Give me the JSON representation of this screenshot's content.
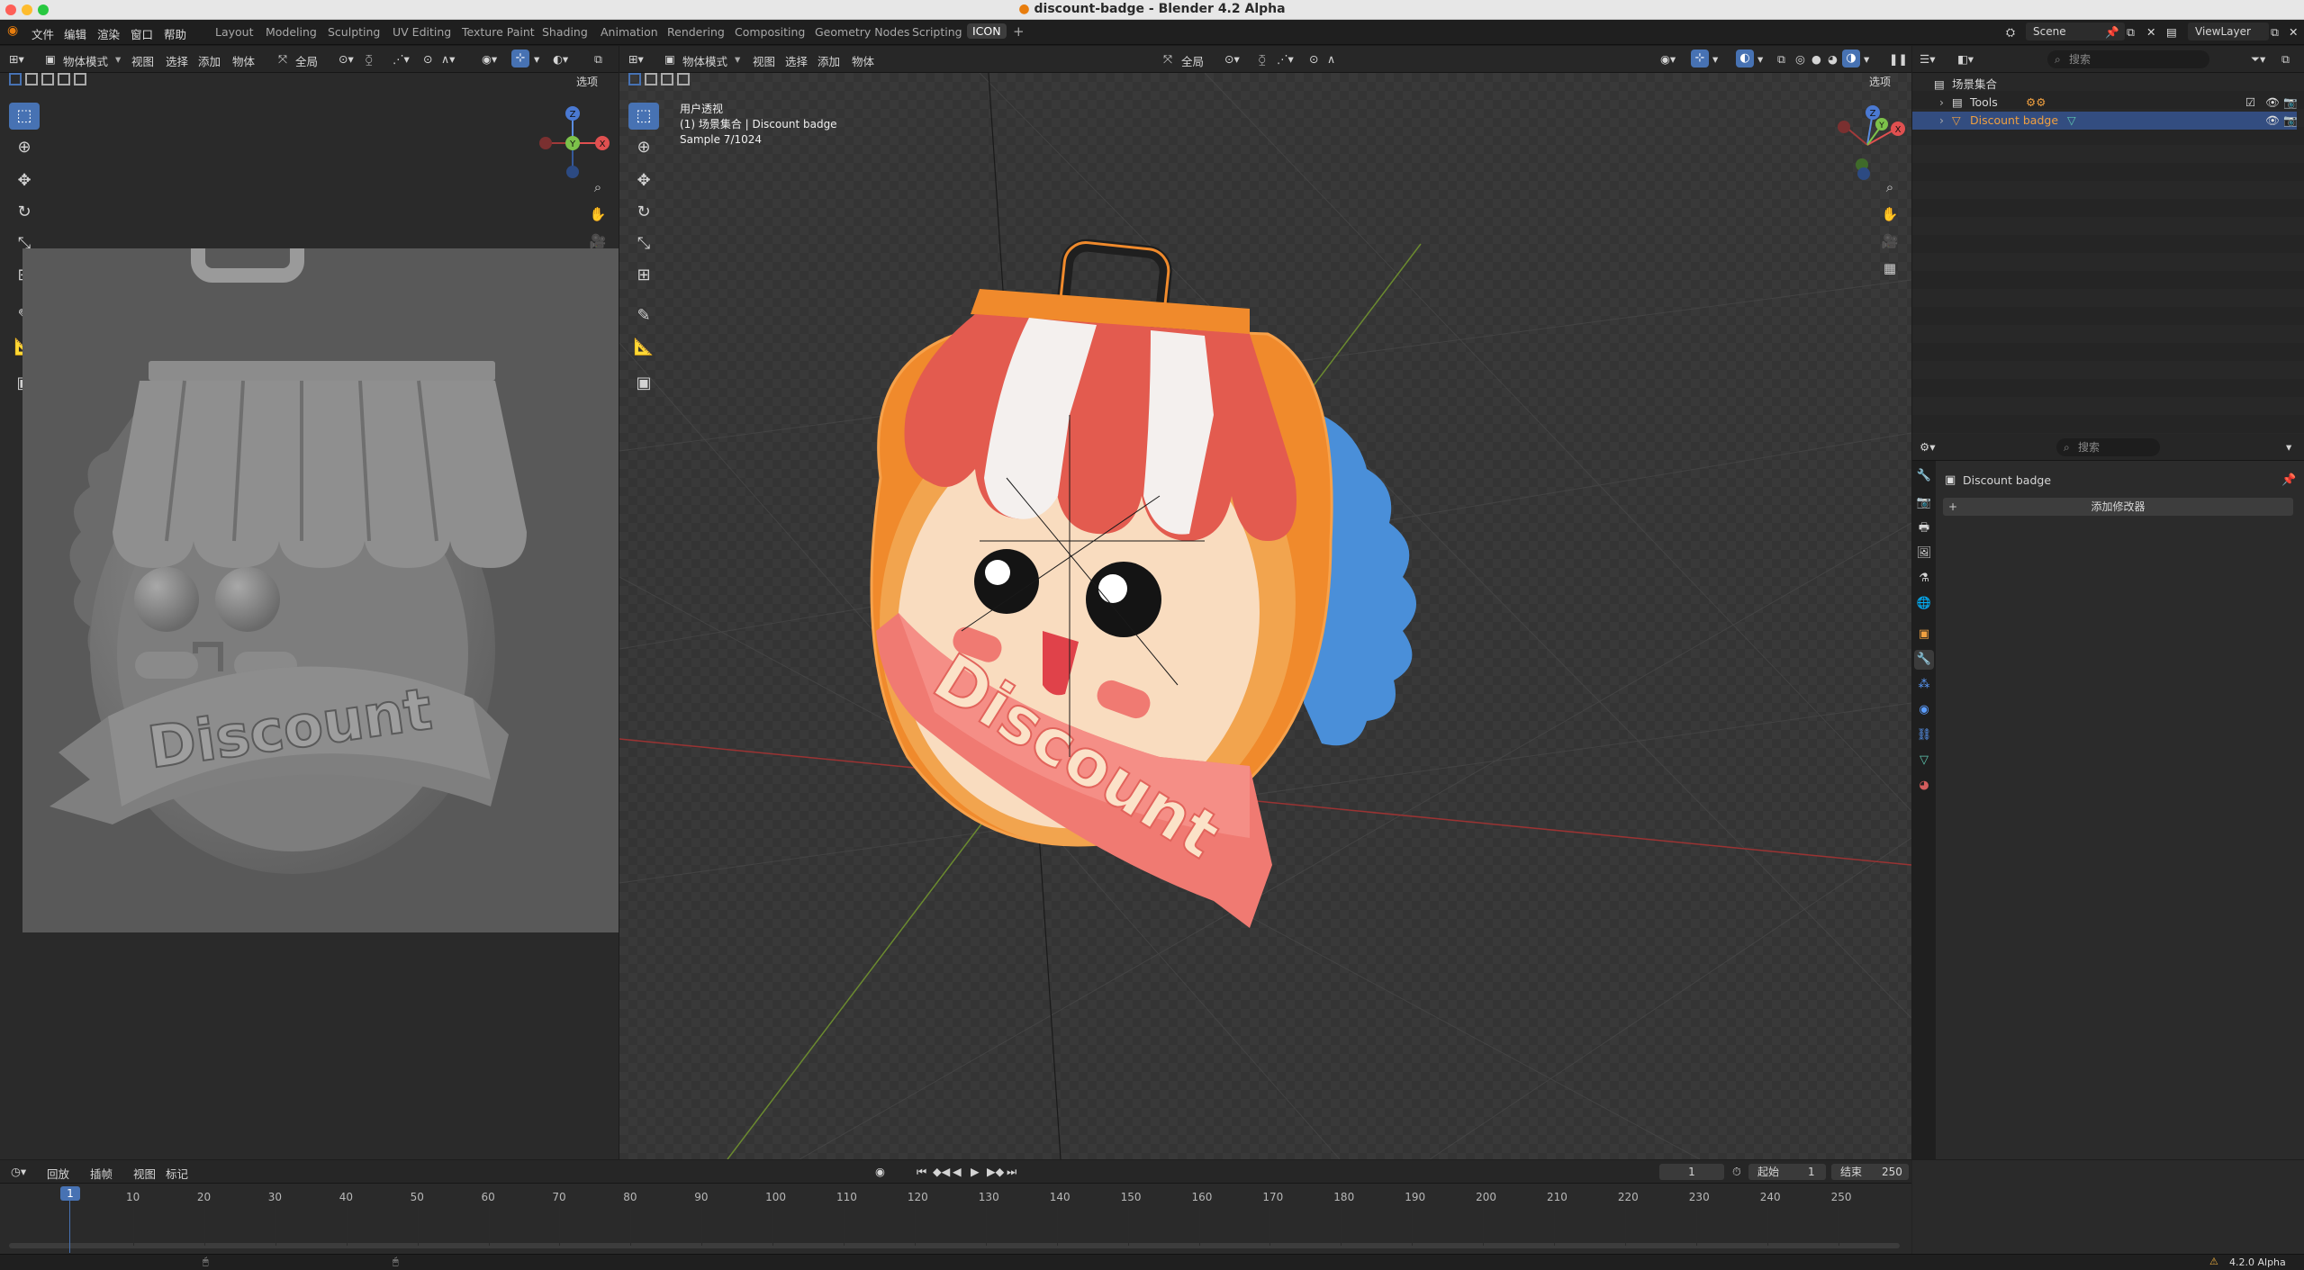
{
  "window": {
    "title": "discount-badge - Blender 4.2 Alpha"
  },
  "menu": {
    "file": "文件",
    "edit": "编辑",
    "render": "渲染",
    "window": "窗口",
    "help": "帮助"
  },
  "workspaces": [
    "Layout",
    "Modeling",
    "Sculpting",
    "UV Editing",
    "Texture Paint",
    "Shading",
    "Animation",
    "Rendering",
    "Compositing",
    "Geometry Nodes",
    "Scripting",
    "ICON"
  ],
  "active_workspace": "ICON",
  "scene": {
    "name": "Scene",
    "view_layer": "ViewLayer"
  },
  "left_viewport": {
    "mode": "物体模式",
    "view": "视图",
    "select": "选择",
    "add": "添加",
    "object": "物体",
    "transform": "全局",
    "options": "选项"
  },
  "main_viewport": {
    "mode": "物体模式",
    "view": "视图",
    "select": "选择",
    "add": "添加",
    "object": "物体",
    "transform": "全局",
    "options": "选项",
    "overlay_line1": "用户透视",
    "overlay_line2": "(1) 场景集合 | Discount badge",
    "overlay_line3": "Sample 7/1024"
  },
  "model": {
    "banner_text": "Discount",
    "left_banner_text": "Discount"
  },
  "gizmo": {
    "x": "X",
    "y": "Y",
    "z": "Z"
  },
  "colors": {
    "accent": "#4772b3",
    "selected_text": "#f0a040",
    "awning_red": "#e05a4f",
    "badge_orange": "#f08a2c",
    "ribbon_pink": "#f07a72",
    "back_blue": "#4a8fd9"
  },
  "outliner": {
    "search_placeholder": "搜索",
    "root": "场景集合",
    "items": [
      {
        "name": "Tools",
        "selected": false
      },
      {
        "name": "Discount badge",
        "selected": true
      }
    ]
  },
  "properties": {
    "search_placeholder": "搜索",
    "object_name": "Discount badge",
    "add_modifier": "添加修改器"
  },
  "timeline": {
    "playback": "回放",
    "keying": "插帧",
    "view": "视图",
    "marker": "标记",
    "current_frame": "1",
    "start_label": "起始",
    "start": "1",
    "end_label": "结束",
    "end": "250",
    "ticks": [
      "1",
      "10",
      "20",
      "30",
      "40",
      "50",
      "60",
      "70",
      "80",
      "90",
      "100",
      "110",
      "120",
      "130",
      "140",
      "150",
      "160",
      "170",
      "180",
      "190",
      "200",
      "210",
      "220",
      "230",
      "240",
      "250"
    ]
  },
  "status": {
    "version": "4.2.0 Alpha"
  }
}
